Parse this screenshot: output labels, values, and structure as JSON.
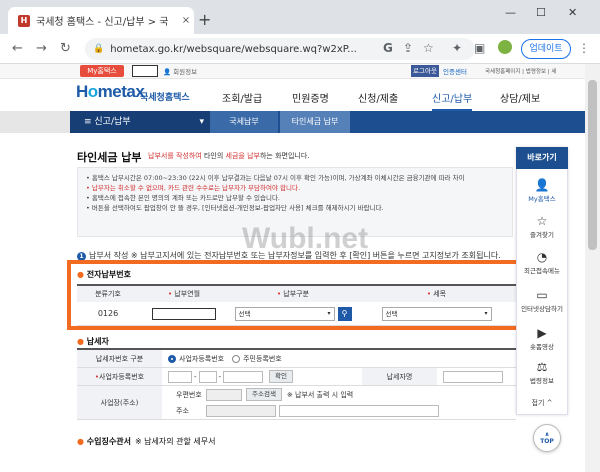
{
  "browser": {
    "tab_title": "국세청 홈택스 - 신고/납부 > 국",
    "tab_close": "×",
    "new_tab": "+",
    "url": "hometax.go.kr/websquare/websquare.wq?w2xP...",
    "update_button": "업데이트",
    "win_min": "—",
    "win_max": "☐",
    "win_close": "✕"
  },
  "topbar": {
    "my_hometax": "My홈택스",
    "member_info": "회원정보",
    "logout": "로그아웃",
    "cert": "인증센터",
    "links": "국세청홈페이지 | 법령정보 | 세"
  },
  "header": {
    "logo_pre": "H",
    "logo_o": "o",
    "logo_post": "metax",
    "logo_sub": "국세청홈택스",
    "menu": [
      "조회/발급",
      "민원증명",
      "신청/제출",
      "신고/납부",
      "상담/제보"
    ]
  },
  "bluenav": {
    "section": "≡  신고/납부",
    "crumb1": "국세납부",
    "crumb2": "타인세금 납부"
  },
  "page": {
    "title": "타인세금 납부",
    "desc_pre": "",
    "desc_red1": "납부서를 작성하여",
    "desc_mid": " 타인의 ",
    "desc_red2": "세금을 납부",
    "desc_post": "하는 화면입니다."
  },
  "notice": [
    "• 홈택스 납부시간은 07:00~23:30 (22시 이후 납부결과는 다음날 07시 이후 확인 가능)이며, 가상계좌 이체시간은 금융기관에 따라 차이",
    "• 납부자는 취소할 수 없으며, 카드 관련 수수료는 납부자가 부담하여야 합니다.",
    "• 홈택스에 접속한 본인 명의의 계좌 또는 카드로만 납부할 수 있습니다.",
    "• 버튼을 선택하여도 팝업창이 안 뜰 경우, [인터넷옵션-개인정보-팝업차단 사용] 체크를 해제하시기 바랍니다."
  ],
  "step_text": "납부서 작성  ※ 납부고지서에 있는 전자납부번호 또는 납부자정보를 입력한 후 [확인] 버튼을 누르면 고지정보가 조회됩니다.",
  "watermark": "Wubl.net",
  "elec": {
    "title": "전자납부번호",
    "headers": [
      "분류기호",
      "납부연월",
      "납부구분",
      "세목"
    ],
    "class_code": "0126",
    "select1": "선택",
    "select2": "선택",
    "search_icon": "🔍"
  },
  "payer": {
    "title": "납세자",
    "rows": {
      "type_label": "납세자번호 구분",
      "opt1": "사업자등록번호",
      "opt2": "주민등록번호",
      "bizno_label": "사업자등록번호",
      "confirm": "확인",
      "name_label": "납세자명",
      "addr_label": "사업장(주소)",
      "zip_label": "우편번호",
      "zip_search": "주소검색",
      "addr_note": "※ 납부서 출력 시 입력",
      "addr2_label": "주소"
    }
  },
  "receipt": {
    "title": "수입징수관서",
    "note": "※ 납세자의 관할 세무서"
  },
  "quick": {
    "header": "바로가기",
    "items": [
      "My홈택스",
      "즐겨찾기",
      "최근접속메뉴",
      "인터넷상담하기",
      "숏폼영상",
      "법령정보"
    ],
    "fold": "접기 ^",
    "top": "TOP"
  }
}
